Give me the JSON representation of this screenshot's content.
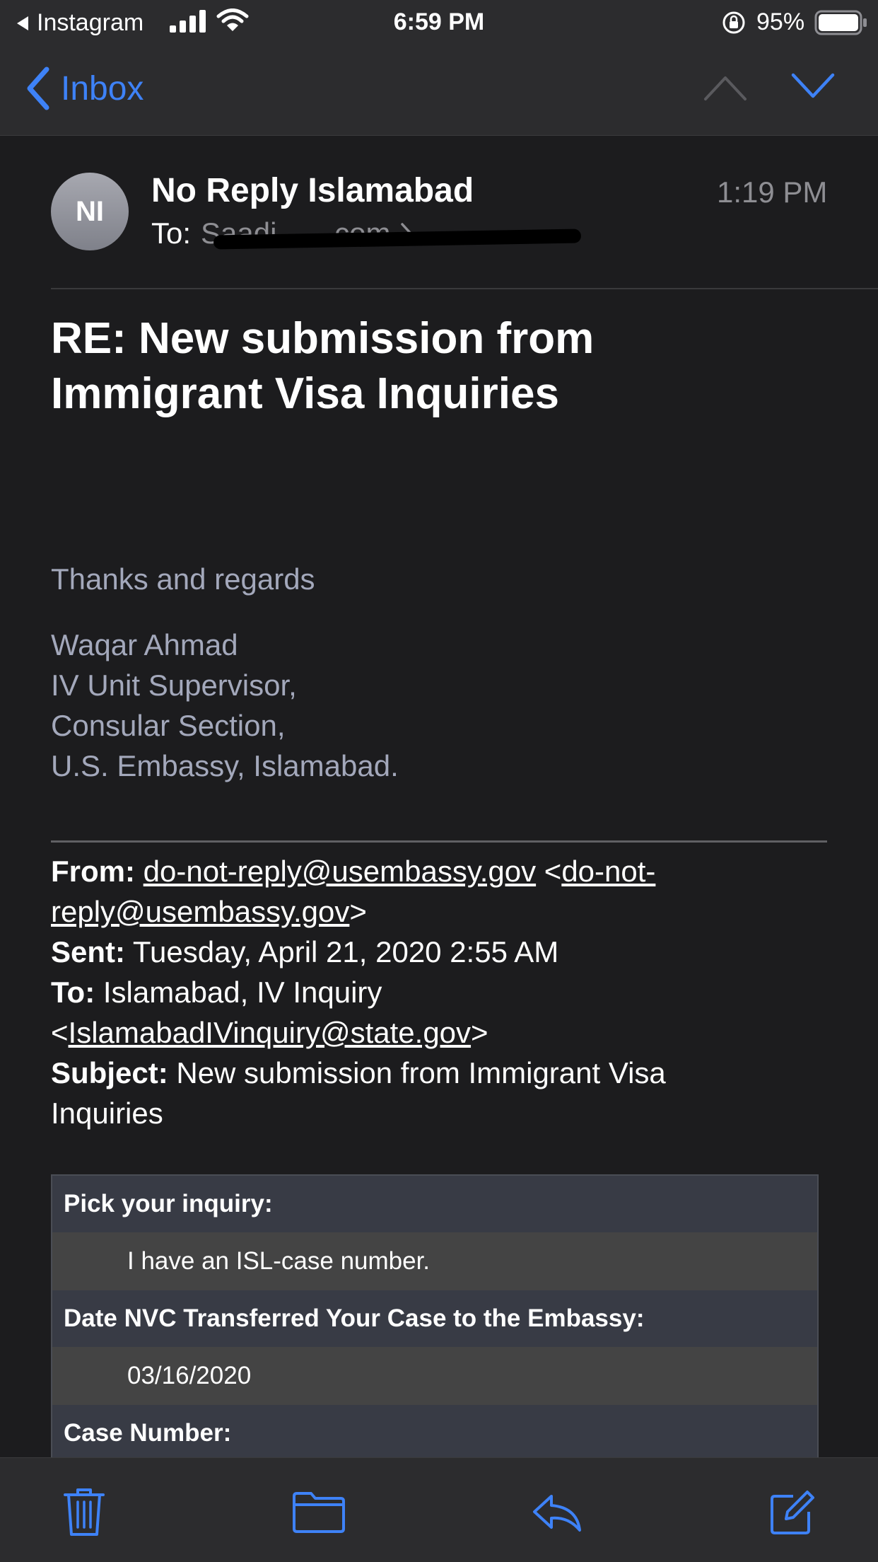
{
  "status_bar": {
    "back_app": "Instagram",
    "time": "6:59 PM",
    "battery": "95%"
  },
  "nav": {
    "back_label": "Inbox"
  },
  "message": {
    "avatar_initials": "NI",
    "sender": "No Reply Islamabad",
    "to_label": "To:",
    "to_address_visible": "Saadi... ...com",
    "time": "1:19 PM",
    "subject_line1": "RE:  New submission from",
    "subject_line2": "Immigrant Visa Inquiries"
  },
  "signature": {
    "closing": "Thanks and regards",
    "name": "Waqar Ahmad",
    "title": "IV Unit Supervisor,",
    "section": "Consular Section,",
    "org": "U.S. Embassy, Islamabad."
  },
  "quoted": {
    "from_label": "From:",
    "from_email": "do-not-reply@usembassy.gov",
    "from_email_part1": "do-not-",
    "from_email_part2": "reply@usembassy.gov",
    "sent_label": "Sent:",
    "sent_value": "Tuesday, April 21, 2020 2:55 AM",
    "to_label": "To:",
    "to_name": "Islamabad, IV Inquiry",
    "to_email": "IslamabadIVinquiry@state.gov",
    "subject_label": "Subject:",
    "subject_value_line1": "New submission from Immigrant Visa",
    "subject_value_line2": "Inquiries"
  },
  "form": {
    "rows": [
      {
        "label": "Pick your inquiry:",
        "value": "I have an ISL-case number."
      },
      {
        "label": "Date NVC Transferred Your Case to the Embassy:",
        "value": "03/16/2020"
      },
      {
        "label": "Case Number:",
        "value": ""
      }
    ]
  },
  "colors": {
    "accent": "#3e82f7",
    "background": "#1c1c1e",
    "bars": "#2c2c2e",
    "signature_text": "#a3a8bb"
  }
}
